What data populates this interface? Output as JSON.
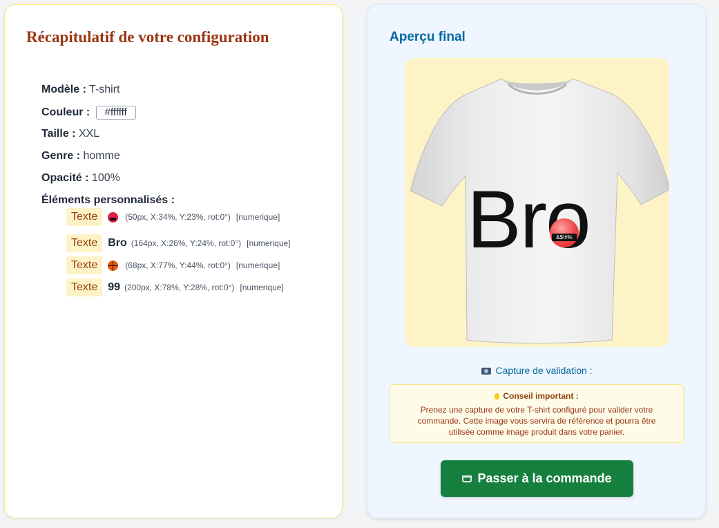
{
  "summary": {
    "title": "Récapitulatif de votre configuration",
    "specs": {
      "model_label": "Modèle :",
      "model_value": "T-shirt",
      "color_label": "Couleur :",
      "color_value": "#ffffff",
      "size_label": "Taille :",
      "size_value": "XXL",
      "gender_label": "Genre :",
      "gender_value": "homme",
      "opacity_label": "Opacité :",
      "opacity_value": "100%",
      "elements_label": "Éléments personnalisés :"
    },
    "elements": [
      {
        "badge": "Texte",
        "icon": "face-with-symbols-on-mouth-icon",
        "content": "",
        "meta": "(50px, X:34%, Y:23%, rot:0°)",
        "type": "[numerique]"
      },
      {
        "badge": "Texte",
        "icon": "",
        "content": "Bro",
        "meta": "(164px, X:26%, Y:24%, rot:0°)",
        "type": "[numerique]"
      },
      {
        "badge": "Texte",
        "icon": "basketball-icon",
        "content": "",
        "meta": "(68px, X:77%, Y:44%, rot:0°)",
        "type": "[numerique]"
      },
      {
        "badge": "Texte",
        "icon": "",
        "content": "99",
        "meta": "(200px, X:78%, Y:28%, rot:0°)",
        "type": "[numerique]"
      }
    ]
  },
  "preview": {
    "title": "Aperçu final",
    "shirt_color": "#ffffff",
    "background_color": "#fef3c7",
    "print_text": "Bro",
    "capture_label": "Capture de validation :",
    "tip_title": "Conseil important :",
    "tip_text": "Prenez une capture de votre T-shirt configuré pour valider votre commande. Cette image vous servira de référence et pourra être utilisée comme image produit dans votre panier.",
    "order_button": "Passer à la commande",
    "accent_color": "#15803d"
  }
}
